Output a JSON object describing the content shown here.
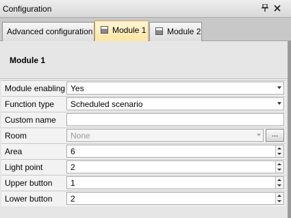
{
  "window": {
    "title": "Configuration",
    "pin_icon": "pin-icon",
    "close_icon": "close-icon"
  },
  "tabs": [
    {
      "label": "Advanced configuration",
      "active": false
    },
    {
      "label": "Module 1",
      "active": true,
      "icon": "module-icon"
    },
    {
      "label": "Module 2",
      "active": false,
      "icon": "module-icon"
    }
  ],
  "panel": {
    "heading": "Module 1",
    "properties": [
      {
        "label": "Module enabling",
        "value": "Yes",
        "type": "dropdown"
      },
      {
        "label": "Function type",
        "value": "Scheduled scenario",
        "type": "dropdown"
      },
      {
        "label": "Custom name",
        "value": "",
        "type": "text"
      },
      {
        "label": "Room",
        "value": "None",
        "type": "dropdown-disabled",
        "button_label": "..."
      },
      {
        "label": "Area",
        "value": "6",
        "type": "spinner"
      },
      {
        "label": "Light point",
        "value": "2",
        "type": "spinner"
      },
      {
        "label": "Upper button",
        "value": "1",
        "type": "spinner"
      },
      {
        "label": "Lower button",
        "value": "2",
        "type": "spinner"
      }
    ]
  },
  "colors": {
    "active_tab": "#ffe3a0",
    "active_tab_border": "#d8a84c",
    "panel_background": "#e6e6e6"
  }
}
